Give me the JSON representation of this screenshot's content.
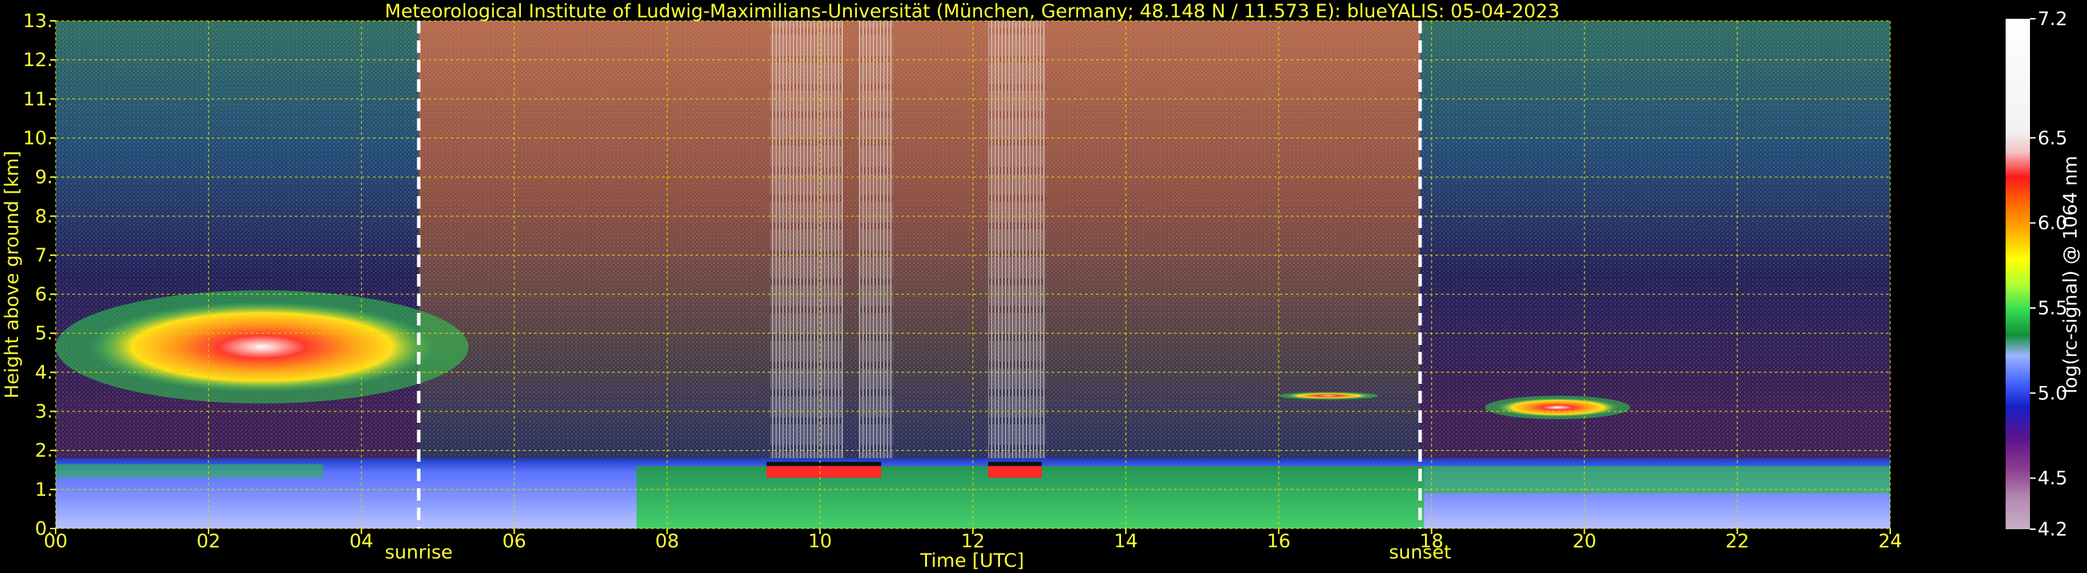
{
  "chart_data": {
    "type": "heatmap",
    "title": "Meteorological Institute of Ludwig-Maximilians-Universität (München, Germany; 48.148 N / 11.573 E):    blueYALIS: 05-04-2023",
    "xlabel": "Time [UTC]",
    "ylabel": "Height above ground [km]",
    "xlim": [
      0,
      24
    ],
    "ylim": [
      0,
      13
    ],
    "x_ticks": [
      "00",
      "02",
      "04",
      "06",
      "08",
      "10",
      "12",
      "14",
      "16",
      "18",
      "20",
      "22",
      "24"
    ],
    "y_ticks": [
      "0.",
      "1.",
      "2.",
      "3.",
      "4.",
      "5.",
      "6.",
      "7.",
      "8.",
      "9.",
      "10.",
      "11.",
      "12.",
      "13."
    ],
    "grid": true,
    "annotations": [
      {
        "label": "sunrise",
        "x": 4.75
      },
      {
        "label": "sunset",
        "x": 17.85
      }
    ],
    "colorbar": {
      "label": "log(rc-signal) @ 1064 nm",
      "range": [
        4.2,
        7.2
      ],
      "ticks": [
        "7.2",
        "6.5",
        "6.0",
        "5.5",
        "5.0",
        "4.5",
        "4.2"
      ],
      "tick_values": [
        7.2,
        6.5,
        6.0,
        5.5,
        5.0,
        4.5,
        4.2
      ]
    },
    "features": [
      {
        "name": "boundary layer aerosol",
        "x": [
          0,
          24
        ],
        "height_km": [
          0.0,
          1.8
        ],
        "signal": 5.3
      },
      {
        "name": "cloud layer",
        "x": [
          0.0,
          5.4
        ],
        "height_km": [
          3.2,
          6.1
        ],
        "signal": 6.0
      },
      {
        "name": "cloud layer",
        "x": [
          16.0,
          17.3
        ],
        "height_km": [
          3.3,
          3.5
        ],
        "signal": 6.2
      },
      {
        "name": "cloud layer",
        "x": [
          18.7,
          20.6
        ],
        "height_km": [
          2.8,
          3.4
        ],
        "signal": 6.2
      },
      {
        "name": "low cloud base",
        "x": [
          9.3,
          10.8
        ],
        "height_km": [
          1.3,
          1.6
        ],
        "signal": 6.3
      },
      {
        "name": "low cloud base",
        "x": [
          12.2,
          12.9
        ],
        "height_km": [
          1.3,
          1.6
        ],
        "signal": 6.3
      }
    ],
    "colors": {
      "text": "#ffff33",
      "grid": "#d6d600",
      "sun_lines": "#ffffff"
    }
  }
}
